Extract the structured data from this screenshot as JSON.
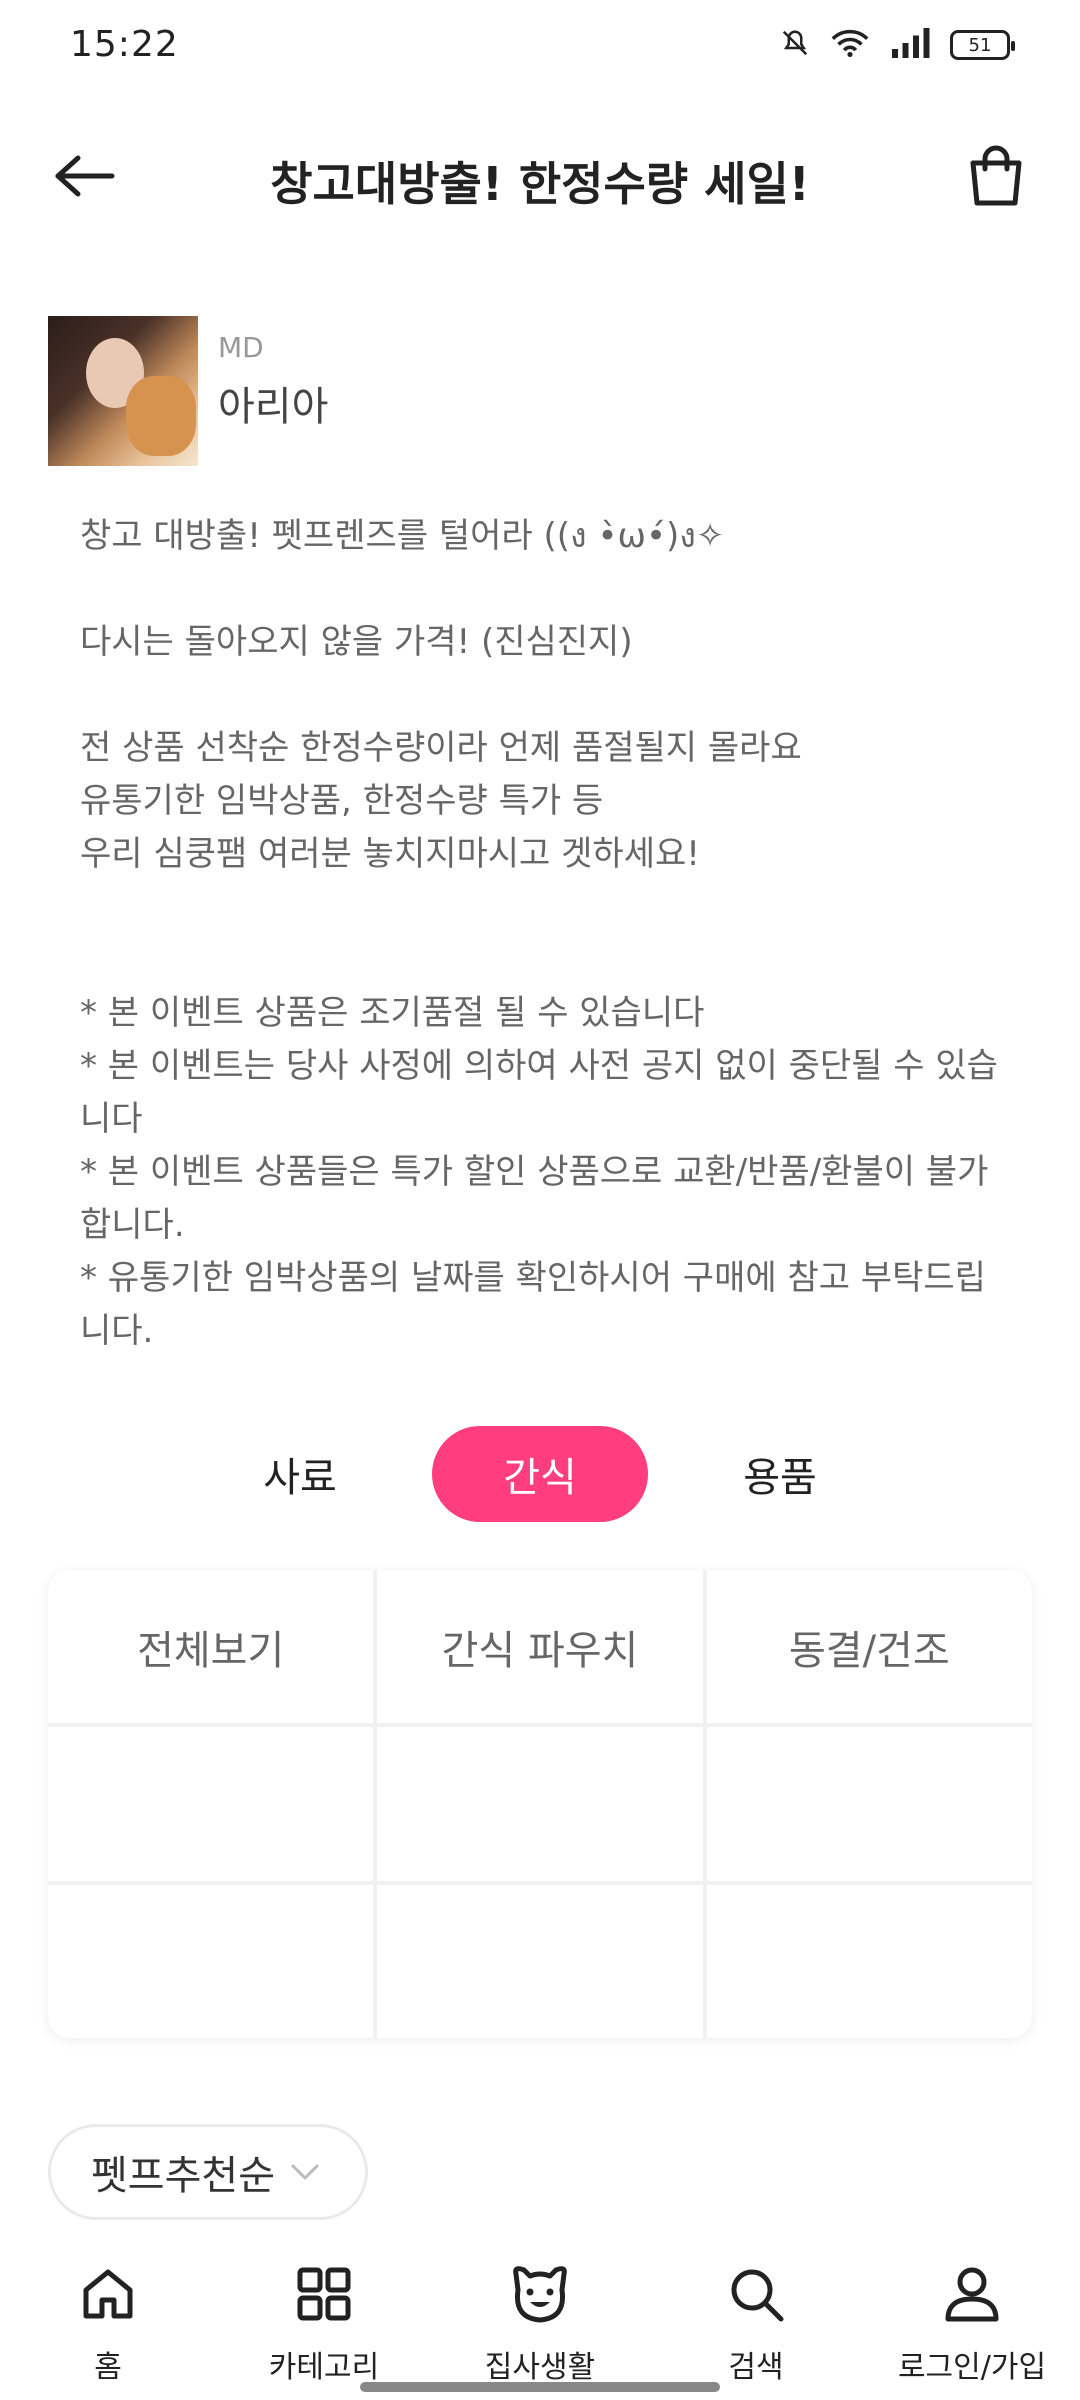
{
  "status_bar": {
    "time": "15:22",
    "battery": "51",
    "icons": [
      "mute-icon",
      "wifi-icon",
      "signal-icon",
      "battery-icon"
    ]
  },
  "header": {
    "title": "창고대방출! 한정수량 세일!",
    "back_icon": "back-arrow-icon",
    "cart_icon": "shopping-bag-icon"
  },
  "md": {
    "label": "MD",
    "name": "아리아"
  },
  "description": {
    "line1": "창고 대방출! 펫프렌즈를 털어라 ((ง •̀ω•́)ง✧",
    "line2": "다시는 돌아오지 않을 가격! (진심진지)",
    "line3": "전 상품 선착순 한정수량이라 언제 품절될지 몰라요",
    "line4": "유통기한 임박상품, 한정수량 특가 등",
    "line5": "우리 심쿵팸 여러분 놓치지마시고 겟하세요!",
    "notice1": "* 본 이벤트 상품은 조기품절 될 수 있습니다",
    "notice2": "* 본 이벤트는 당사 사정에 의하여 사전 공지 없이 중단될 수 있습니다",
    "notice3": "* 본 이벤트 상품들은 특가 할인 상품으로 교환/반품/환불이 불가합니다.",
    "notice4": "* 유통기한 임박상품의 날짜를 확인하시어 구매에 참고 부탁드립니다."
  },
  "tabs": [
    {
      "label": "사료",
      "active": false
    },
    {
      "label": "간식",
      "active": true
    },
    {
      "label": "용품",
      "active": false
    }
  ],
  "subcategories": [
    "전체보기",
    "간식 파우치",
    "동결/건조",
    "",
    "",
    "",
    "",
    "",
    ""
  ],
  "sort": {
    "label": "펫프추천순"
  },
  "bottom_nav": [
    {
      "label": "홈",
      "icon": "home-icon"
    },
    {
      "label": "카테고리",
      "icon": "grid-icon"
    },
    {
      "label": "집사생활",
      "icon": "pet-face-icon"
    },
    {
      "label": "검색",
      "icon": "search-icon"
    },
    {
      "label": "로그인/가입",
      "icon": "user-icon"
    }
  ],
  "colors": {
    "accent": "#ff3d7f"
  }
}
